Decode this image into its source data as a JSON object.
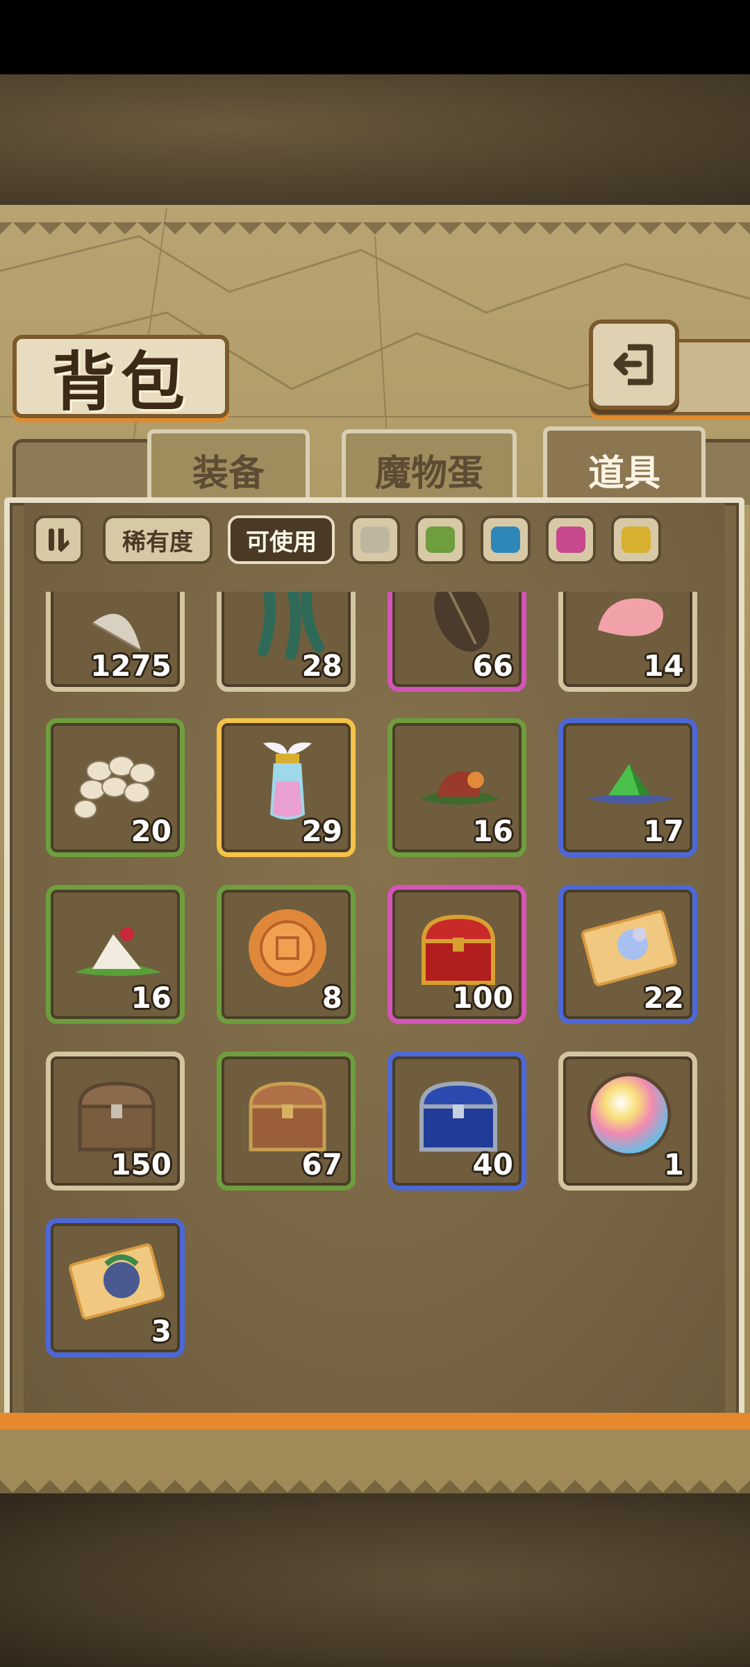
{
  "title": "背包",
  "tabs": [
    {
      "label": "装备",
      "active": false
    },
    {
      "label": "魔物蛋",
      "active": false
    },
    {
      "label": "道具",
      "active": true
    }
  ],
  "filters": {
    "rarity_label": "稀有度",
    "usable_label": "可使用",
    "usable_active": true,
    "colors": [
      "#bfb6a0",
      "#6e9e3e",
      "#2f86b8",
      "#c8488e",
      "#d8b030"
    ]
  },
  "items": [
    {
      "icon": "feather-quill-icon",
      "count": "1275",
      "rarity": "common"
    },
    {
      "icon": "seaweed-icon",
      "count": "28",
      "rarity": "common"
    },
    {
      "icon": "seed-pod-icon",
      "count": "66",
      "rarity": "epic"
    },
    {
      "icon": "pink-petal-icon",
      "count": "14",
      "rarity": "common"
    },
    {
      "icon": "pearl-pile-icon",
      "count": "20",
      "rarity": "uncommon"
    },
    {
      "icon": "winged-potion-icon",
      "count": "29",
      "rarity": "legendary"
    },
    {
      "icon": "roasted-meat-icon",
      "count": "16",
      "rarity": "uncommon"
    },
    {
      "icon": "green-crystal-icon",
      "count": "17",
      "rarity": "rare"
    },
    {
      "icon": "rice-dumpling-icon",
      "count": "16",
      "rarity": "uncommon"
    },
    {
      "icon": "mooncake-icon",
      "count": "8",
      "rarity": "uncommon"
    },
    {
      "icon": "red-chest-icon",
      "count": "100",
      "rarity": "epic"
    },
    {
      "icon": "summon-ticket-icon",
      "count": "22",
      "rarity": "rare"
    },
    {
      "icon": "wooden-chest-icon",
      "count": "150",
      "rarity": "common"
    },
    {
      "icon": "bronze-chest-icon",
      "count": "67",
      "rarity": "uncommon"
    },
    {
      "icon": "blue-chest-icon",
      "count": "40",
      "rarity": "rare"
    },
    {
      "icon": "rainbow-orb-icon",
      "count": "1",
      "rarity": "common"
    },
    {
      "icon": "hero-ticket-icon",
      "count": "3",
      "rarity": "rare"
    }
  ]
}
